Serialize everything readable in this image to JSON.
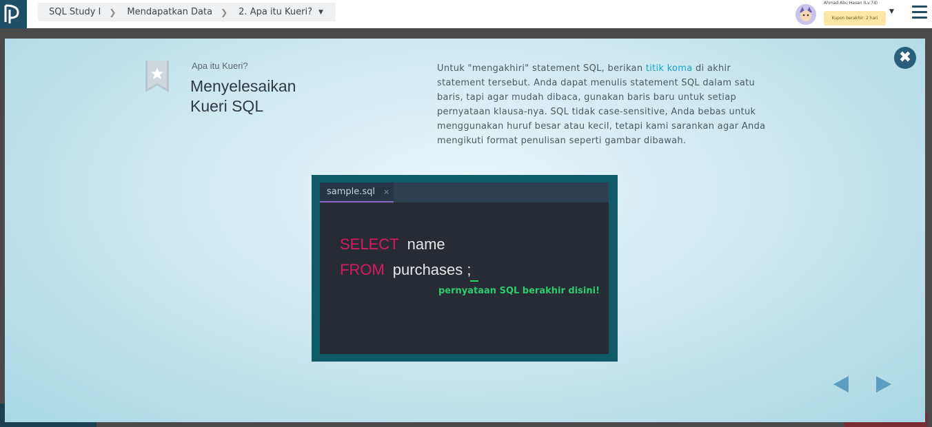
{
  "topbar": {
    "breadcrumbs": [
      "SQL Study I",
      "Mendapatkan Data",
      "2. Apa itu Kueri?"
    ],
    "user_name": "Ahmad Abu Hasan (Lv.74)",
    "coupon": "Kupon berakhir: 2 hari"
  },
  "modal": {
    "subtitle": "Apa itu Kueri?",
    "title": "Menyelesaikan Kueri SQL",
    "body_before": "Untuk \"mengakhiri\" statement SQL, berikan ",
    "body_highlight": "titik koma",
    "body_after": " di akhir statement tersebut. Anda dapat menulis statement SQL dalam satu baris, tapi agar mudah dibaca, gunakan baris baru untuk setiap pernyataan klausa-nya. SQL tidak case-sensitive, Anda bebas untuk menggunakan huruf besar atau kecil, tetapi kami sarankan agar Anda mengikuti format penulisan seperti gambar dibawah.",
    "close_icon": "close-icon"
  },
  "code_example": {
    "tab_name": "sample.sql",
    "tab_close": "×",
    "line1_keyword": "SELECT",
    "line1_rest": "name",
    "line2_keyword": "FROM",
    "line2_rest": "purchases ;",
    "note": "pernyataan SQL berakhir disini!"
  },
  "colors": {
    "keyword": "#d81b60",
    "note": "#2ecc71",
    "link": "#1aa3c8"
  }
}
